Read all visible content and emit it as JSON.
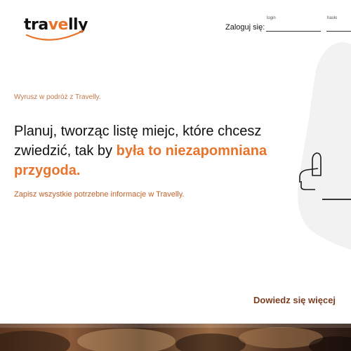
{
  "header": {
    "logo": {
      "text_pre": "tra",
      "text_accent": "ve",
      "text_post": "lly",
      "brand_color": "#e8742c"
    },
    "login_prompt": "Zaloguj się:",
    "login_field": {
      "caption": "login",
      "value": ""
    },
    "password_field": {
      "caption": "hasło",
      "value": ""
    }
  },
  "hero": {
    "tagline": "Wyrusz w podróż z Travelly.",
    "headline_pre": "Planuj, tworząc listę miejc, które chcesz zwiedzić, tak by ",
    "headline_highlight": "była to niezapomniana przygoda.",
    "subline": "Zapisz wszystkie potrzebne informacje w Travelly."
  },
  "cta": {
    "more_label": "Dowiedz się więcej"
  },
  "colors": {
    "accent": "#e8742c",
    "link_brown": "#7a3e1f",
    "blob": "#f2f2f2"
  }
}
